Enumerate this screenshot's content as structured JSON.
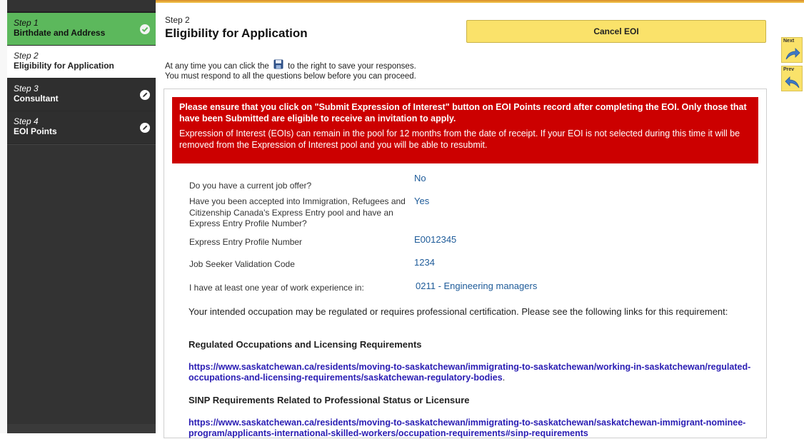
{
  "sidebar": {
    "steps": [
      {
        "num": "Step 1",
        "title": "Birthdate and Address",
        "state": "done",
        "icon": "check-icon"
      },
      {
        "num": "Step 2",
        "title": "Eligibility for Application",
        "state": "active",
        "icon": ""
      },
      {
        "num": "Step 3",
        "title": "Consultant",
        "state": "pending",
        "icon": "pencil-icon"
      },
      {
        "num": "Step 4",
        "title": "EOI Points",
        "state": "pending",
        "icon": "pencil-icon"
      }
    ]
  },
  "header": {
    "step_label": "Step 2",
    "title": "Eligibility for Application",
    "cancel_label": "Cancel EOI"
  },
  "intro": {
    "line1_before": "At any time you can click the",
    "line1_after": "to the right to save your responses.",
    "line2": "You must respond to all the questions below before you can proceed."
  },
  "alert": {
    "strong": "Please ensure that you click on \"Submit Expression of Interest\" button on EOI Points record after completing the EOI. Only those that have been Submitted are eligible to receive an invitation to apply.",
    "normal": "Expression of Interest (EOIs) can remain in the pool for 12 months from the date of receipt. If your EOI is not selected during this time it will be removed from the Expression of Interest pool and you will be able to resubmit."
  },
  "questions": [
    {
      "q": "Do you have a current job offer?",
      "a": "No"
    },
    {
      "q": "Have you been accepted into Immigration, Refugees and Citizenship Canada's Express Entry pool and have an Express Entry Profile Number?",
      "a": "Yes"
    },
    {
      "q": "Express Entry Profile Number",
      "a": "E0012345"
    },
    {
      "q": "Job Seeker Validation Code",
      "a": "1234"
    },
    {
      "q": "I have at least one year of work experience in:",
      "a": "0211 - Engineering managers"
    }
  ],
  "content": {
    "occupation_note": "Your intended occupation may be regulated or requires professional certification. Please see the following links for this requirement:",
    "heading1": "Regulated Occupations and Licensing Requirements",
    "link1": "https://www.saskatchewan.ca/residents/moving-to-saskatchewan/immigrating-to-saskatchewan/working-in-saskatchewan/regulated-occupations-and-licensing-requirements/saskatchewan-regulatory-bodies",
    "link1_tail": ".",
    "heading2": "SINP Requirements Related to Professional Status or Licensure",
    "link2": "https://www.saskatchewan.ca/residents/moving-to-saskatchewan/immigrating-to-saskatchewan/saskatchewan-immigrant-nominee-program/applicants-international-skilled-workers/occupation-requirements#sinp-requirements"
  },
  "side_nav": {
    "next_label": "Next",
    "prev_label": "Prev"
  },
  "colors": {
    "step_done": "#5cb85c",
    "alert_red": "#cc0000",
    "answer_blue": "#1e5b99",
    "link_purple": "#2a1db3",
    "button_yellow": "#fae26a"
  }
}
